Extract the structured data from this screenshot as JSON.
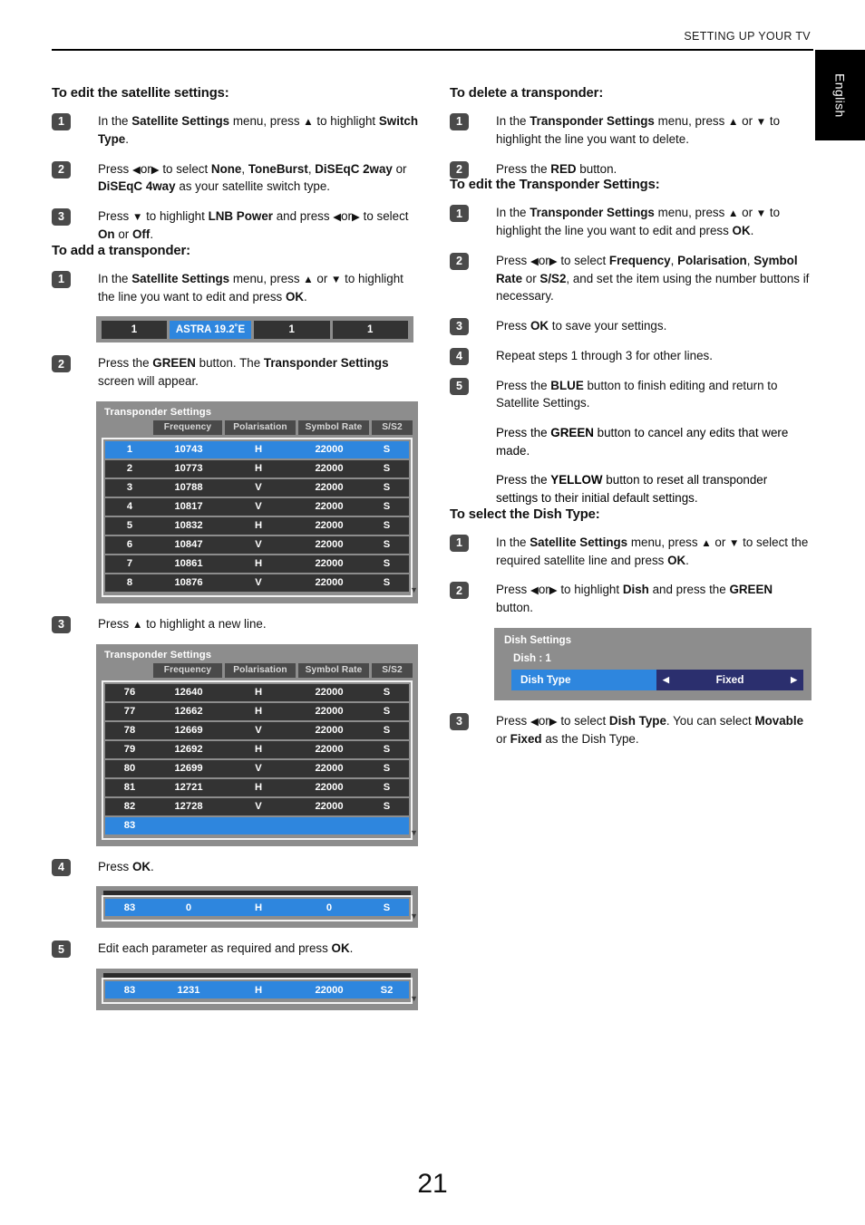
{
  "header": {
    "title": "SETTING UP YOUR TV",
    "language_tab": "English"
  },
  "page_number": "21",
  "left_column": {
    "sections": [
      {
        "heading": "To edit the satellite settings:",
        "steps": [
          {
            "num": "1",
            "html": "In the <b>Satellite Settings</b> menu, press <span class=\"arw\">▲</span> to highlight <b>Switch Type</b>."
          },
          {
            "num": "2",
            "html": "Press <span class=\"arw\">◀</span>or<span class=\"arw\">▶</span> to select <b>None</b>, <b>ToneBurst</b>, <b>DiSEqC 2way</b> or <b>DiSEqC 4way</b> as your satellite switch type."
          },
          {
            "num": "3",
            "html": "Press <span class=\"arw\">▼</span> to highlight <b>LNB Power</b> and press <span class=\"arw\">◀</span>or<span class=\"arw\">▶</span> to select <b>On</b> or <b>Off</b>."
          }
        ]
      },
      {
        "heading": "To add a transponder:",
        "steps": [
          {
            "num": "1",
            "html": "In the <b>Satellite Settings</b> menu, press <span class=\"arw\">▲</span> or <span class=\"arw\">▼</span> to highlight the line you want to edit and press <b>OK</b>."
          },
          {
            "num": "2",
            "html": "Press the <b>GREEN</b> button. The <b>Transponder Settings</b> screen will appear."
          },
          {
            "num": "3",
            "html": "Press <span class=\"arw\">▲</span> to highlight a new line."
          },
          {
            "num": "4",
            "html": "Press <b>OK</b>."
          },
          {
            "num": "5",
            "html": "Edit each parameter as required and press <b>OK</b>."
          }
        ]
      }
    ]
  },
  "right_column": {
    "sections": [
      {
        "heading": "To delete a transponder:",
        "steps": [
          {
            "num": "1",
            "html": "In the <b>Transponder Settings</b> menu, press <span class=\"arw\">▲</span> or <span class=\"arw\">▼</span> to highlight the line you want to delete."
          },
          {
            "num": "2",
            "html": "Press the <b>RED</b> button."
          }
        ]
      },
      {
        "heading": "To edit the Transponder Settings:",
        "steps": [
          {
            "num": "1",
            "html": "In the <b>Transponder Settings</b> menu, press <span class=\"arw\">▲</span> or <span class=\"arw\">▼</span> to highlight the line you want to edit and press <b>OK</b>."
          },
          {
            "num": "2",
            "html": "Press <span class=\"arw\">◀</span>or<span class=\"arw\">▶</span> to select <b>Frequency</b>, <b>Polarisation</b>, <b>Symbol Rate</b> or <b>S/S2</b>, and set the item using the number buttons if necessary."
          },
          {
            "num": "3",
            "html": "Press <b>OK</b> to save your settings."
          },
          {
            "num": "4",
            "html": "Repeat steps 1 through 3 for other lines."
          },
          {
            "num": "5",
            "html": "Press the <b>BLUE</b> button to finish editing and return to Satellite Settings."
          }
        ],
        "extra_paragraphs": [
          "Press the <b>GREEN</b> button to cancel any edits that were made.",
          "Press the <b>YELLOW</b> button to reset all transponder settings to their initial default settings."
        ]
      },
      {
        "heading": "To select the Dish Type:",
        "steps": [
          {
            "num": "1",
            "html": "In the <b>Satellite Settings</b> menu, press <span class=\"arw\">▲</span> or <span class=\"arw\">▼</span> to select the required satellite line and press <b>OK</b>."
          },
          {
            "num": "2",
            "html": "Press <span class=\"arw\">◀</span>or<span class=\"arw\">▶</span> to highlight <b>Dish</b> and press the <b>GREEN</b> button."
          },
          {
            "num": "3",
            "html": "Press <span class=\"arw\">◀</span>or<span class=\"arw\">▶</span> to select <b>Dish Type</b>. You can select <b>Movable</b> or <b>Fixed</b> as the Dish Type."
          }
        ]
      }
    ]
  },
  "satellite_bar": {
    "cells": [
      "1",
      "ASTRA 19.2˚E",
      "1",
      "1"
    ],
    "selected_index": 1
  },
  "transponder_table_1": {
    "title": "Transponder Settings",
    "columns": [
      "",
      "Frequency",
      "Polarisation",
      "Symbol Rate",
      "S/S2"
    ],
    "selected_row": 0,
    "rows": [
      [
        "1",
        "10743",
        "H",
        "22000",
        "S"
      ],
      [
        "2",
        "10773",
        "H",
        "22000",
        "S"
      ],
      [
        "3",
        "10788",
        "V",
        "22000",
        "S"
      ],
      [
        "4",
        "10817",
        "V",
        "22000",
        "S"
      ],
      [
        "5",
        "10832",
        "H",
        "22000",
        "S"
      ],
      [
        "6",
        "10847",
        "V",
        "22000",
        "S"
      ],
      [
        "7",
        "10861",
        "H",
        "22000",
        "S"
      ],
      [
        "8",
        "10876",
        "V",
        "22000",
        "S"
      ]
    ],
    "scroll_arrow": "▼"
  },
  "transponder_table_2": {
    "title": "Transponder Settings",
    "columns": [
      "",
      "Frequency",
      "Polarisation",
      "Symbol Rate",
      "S/S2"
    ],
    "selected_row": 7,
    "rows": [
      [
        "76",
        "12640",
        "H",
        "22000",
        "S"
      ],
      [
        "77",
        "12662",
        "H",
        "22000",
        "S"
      ],
      [
        "78",
        "12669",
        "V",
        "22000",
        "S"
      ],
      [
        "79",
        "12692",
        "H",
        "22000",
        "S"
      ],
      [
        "80",
        "12699",
        "V",
        "22000",
        "S"
      ],
      [
        "81",
        "12721",
        "H",
        "22000",
        "S"
      ],
      [
        "82",
        "12728",
        "V",
        "22000",
        "S"
      ],
      [
        "83",
        "",
        "",
        "",
        ""
      ]
    ],
    "scroll_arrow": "▼"
  },
  "result_bar_1": {
    "cells": [
      "83",
      "0",
      "H",
      "0",
      "S"
    ],
    "scroll_arrow": "▼"
  },
  "result_bar_2": {
    "cells": [
      "83",
      "1231",
      "H",
      "22000",
      "S2"
    ],
    "scroll_arrow": "▼"
  },
  "dish_settings": {
    "title": "Dish Settings",
    "dish_line": "Dish : 1",
    "row_label": "Dish Type",
    "row_value": "Fixed",
    "left_arrow": "◀",
    "right_arrow": "▶"
  },
  "colors": {
    "selection_blue": "#2e86de",
    "osd_gray": "#8d8d8d",
    "row_dark": "#333333",
    "value_navy": "#2b2f6e"
  }
}
